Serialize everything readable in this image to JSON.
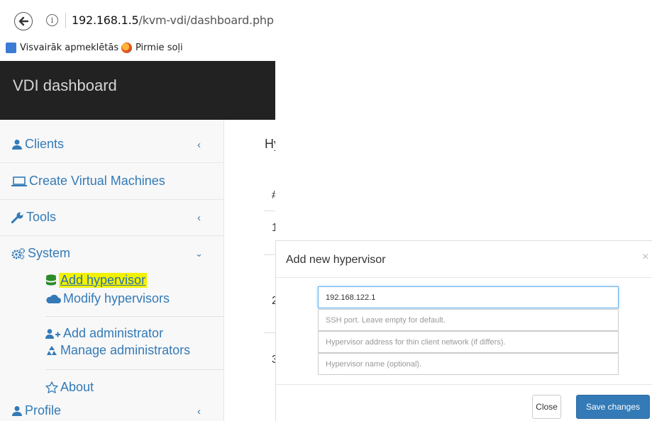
{
  "browser": {
    "url_host": "192.168.1.5",
    "url_path": "/kvm-vdi/dashboard.php",
    "bookmarks": [
      {
        "label": "Visvairāk apmeklētās",
        "icon": "most-visited-icon"
      },
      {
        "label": "Pirmie soļi",
        "icon": "firefox-icon"
      }
    ]
  },
  "app": {
    "brand": "VDI dashboard"
  },
  "sidebar": {
    "clients": "Clients",
    "create_vms": "Create Virtual Machines",
    "tools": "Tools",
    "system": "System",
    "add_hypervisor": "Add hypervisor",
    "modify_hypervisors": "Modify hypervisors",
    "add_administrator": "Add administrator",
    "manage_administrators": "Manage administrators",
    "about": "About",
    "profile": "Profile"
  },
  "main": {
    "heading": "Hy",
    "col_hash": "#",
    "rows": [
      "1",
      "2",
      "3"
    ]
  },
  "modal": {
    "title": "Add new hypervisor",
    "close_symbol": "×",
    "ip_value": "192.168.122.1",
    "ssh_placeholder": "SSH port. Leave empty for default.",
    "thin_placeholder": "Hypervisor address for thin client network (if differs).",
    "name_placeholder": "Hypervisor name (optional).",
    "close_label": "Close",
    "save_label": "Save changes"
  },
  "colors": {
    "link": "#337ab7",
    "header_bg": "#222222",
    "highlight": "#f2f200"
  }
}
